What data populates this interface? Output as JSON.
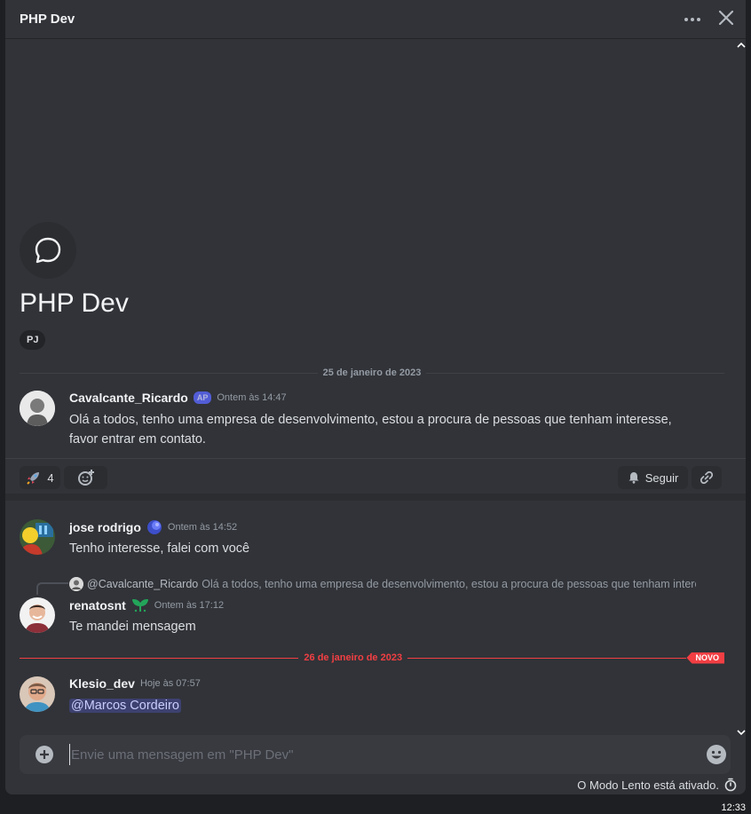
{
  "window": {
    "title": "PHP Dev"
  },
  "thread": {
    "title": "PHP Dev",
    "tag": "PJ"
  },
  "dividers": {
    "first": "25 de janeiro de 2023",
    "second": "26 de janeiro de 2023",
    "new_badge": "NOVO"
  },
  "original_post": {
    "username": "Cavalcante_Ricardo",
    "badge": "AP",
    "timestamp": "Ontem às 14:47",
    "body": "Olá a todos, tenho uma empresa de desenvolvimento, estou a procura de pessoas que tenham interesse, favor entrar em contato."
  },
  "reactions": {
    "rocket_count": "4",
    "follow_label": "Seguir"
  },
  "messages": [
    {
      "username": "jose rodrigo",
      "timestamp": "Ontem às 14:52",
      "body": "Tenho interesse, falei com você"
    },
    {
      "reply_to": {
        "username": "@Cavalcante_Ricardo",
        "text": "Olá a todos, tenho uma empresa de desenvolvimento, estou a procura de pessoas que tenham interesse, favor entrar em contato."
      },
      "username": "renatosnt",
      "timestamp": "Ontem às 17:12",
      "body": "Te mandei mensagem"
    },
    {
      "username": "Klesio_dev",
      "timestamp": "Hoje às 07:57",
      "mention": "@Marcos Cordeiro"
    }
  ],
  "composer": {
    "placeholder": "Envie uma mensagem em \"PHP Dev\""
  },
  "footer": {
    "slowmode": "O Modo Lento está ativado.",
    "clock": "12:33"
  },
  "colors": {
    "background": "#313338",
    "accent": "#5865f2",
    "new_divider": "#f23f43"
  }
}
